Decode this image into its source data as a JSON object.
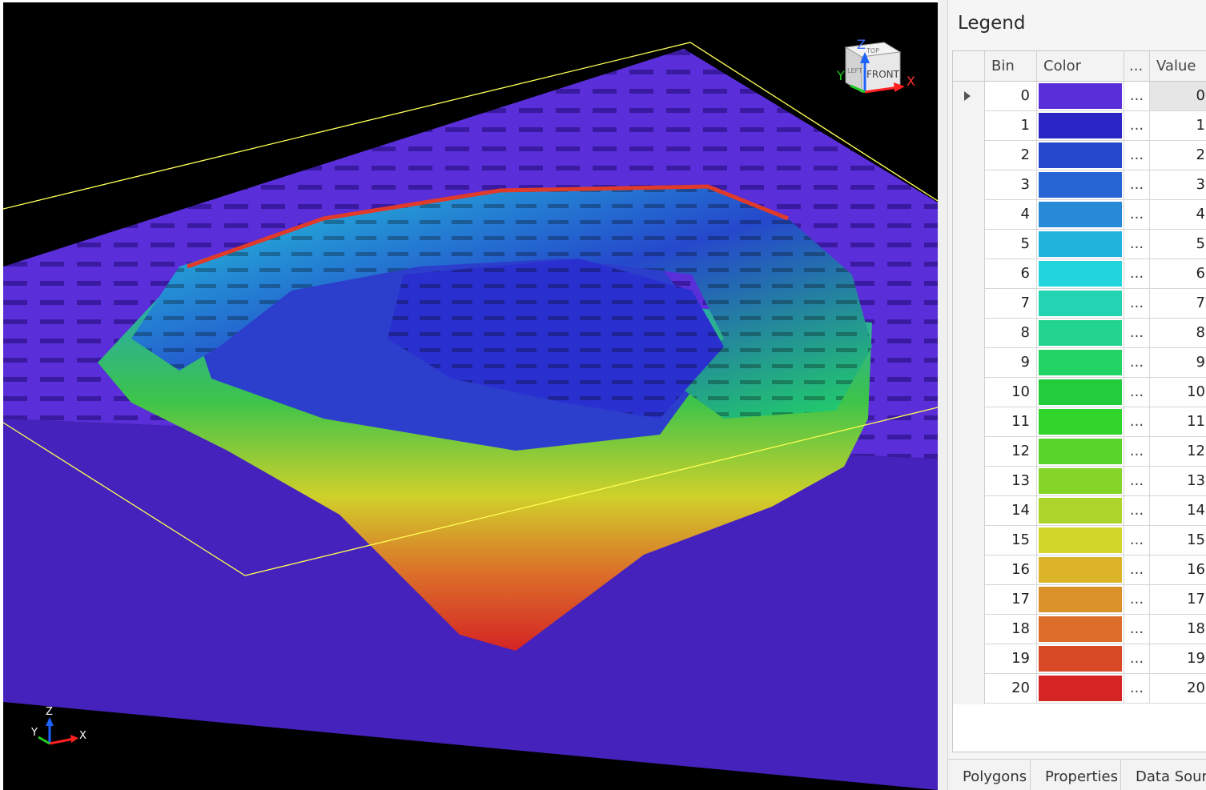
{
  "viewport": {
    "background": "#000000",
    "slab_color": "#4422bb",
    "outline_color": "#ffff55",
    "nav_cube": {
      "top_label": "TOP",
      "front_label": "FRONT",
      "left_label": "LEFT",
      "x_label": "X",
      "y_label": "Y",
      "z_label": "Z"
    },
    "triad": {
      "x_label": "X",
      "y_label": "Y",
      "z_label": "Z"
    }
  },
  "legend": {
    "title": "Legend",
    "columns": {
      "bin": "Bin",
      "color": "Color",
      "dots": "...",
      "value": "Value"
    },
    "selected_row": 0,
    "rows": [
      {
        "bin": "0",
        "color": "#5a2ed8",
        "dots": "...",
        "value": "0"
      },
      {
        "bin": "1",
        "color": "#2c25c6",
        "dots": "...",
        "value": "1"
      },
      {
        "bin": "2",
        "color": "#2548cc",
        "dots": "...",
        "value": "2"
      },
      {
        "bin": "3",
        "color": "#2865d4",
        "dots": "...",
        "value": "3"
      },
      {
        "bin": "4",
        "color": "#268ad6",
        "dots": "...",
        "value": "4"
      },
      {
        "bin": "5",
        "color": "#20b4dc",
        "dots": "...",
        "value": "5"
      },
      {
        "bin": "6",
        "color": "#22d4dc",
        "dots": "...",
        "value": "6"
      },
      {
        "bin": "7",
        "color": "#22d4b2",
        "dots": "...",
        "value": "7"
      },
      {
        "bin": "8",
        "color": "#22d48e",
        "dots": "...",
        "value": "8"
      },
      {
        "bin": "9",
        "color": "#22d464",
        "dots": "...",
        "value": "9"
      },
      {
        "bin": "10",
        "color": "#22cc3a",
        "dots": "...",
        "value": "10"
      },
      {
        "bin": "11",
        "color": "#30d42a",
        "dots": "...",
        "value": "11"
      },
      {
        "bin": "12",
        "color": "#58d42a",
        "dots": "...",
        "value": "12"
      },
      {
        "bin": "13",
        "color": "#84d42a",
        "dots": "...",
        "value": "13"
      },
      {
        "bin": "14",
        "color": "#acd42a",
        "dots": "...",
        "value": "14"
      },
      {
        "bin": "15",
        "color": "#d2d62a",
        "dots": "...",
        "value": "15"
      },
      {
        "bin": "16",
        "color": "#dcb42a",
        "dots": "...",
        "value": "16"
      },
      {
        "bin": "17",
        "color": "#dc922a",
        "dots": "...",
        "value": "17"
      },
      {
        "bin": "18",
        "color": "#dc6e2a",
        "dots": "...",
        "value": "18"
      },
      {
        "bin": "19",
        "color": "#d84a26",
        "dots": "...",
        "value": "19"
      },
      {
        "bin": "20",
        "color": "#d42424",
        "dots": "...",
        "value": "20"
      }
    ]
  },
  "tabs": [
    {
      "label": "Polygons"
    },
    {
      "label": "Properties"
    },
    {
      "label": "Data Sour..."
    }
  ]
}
